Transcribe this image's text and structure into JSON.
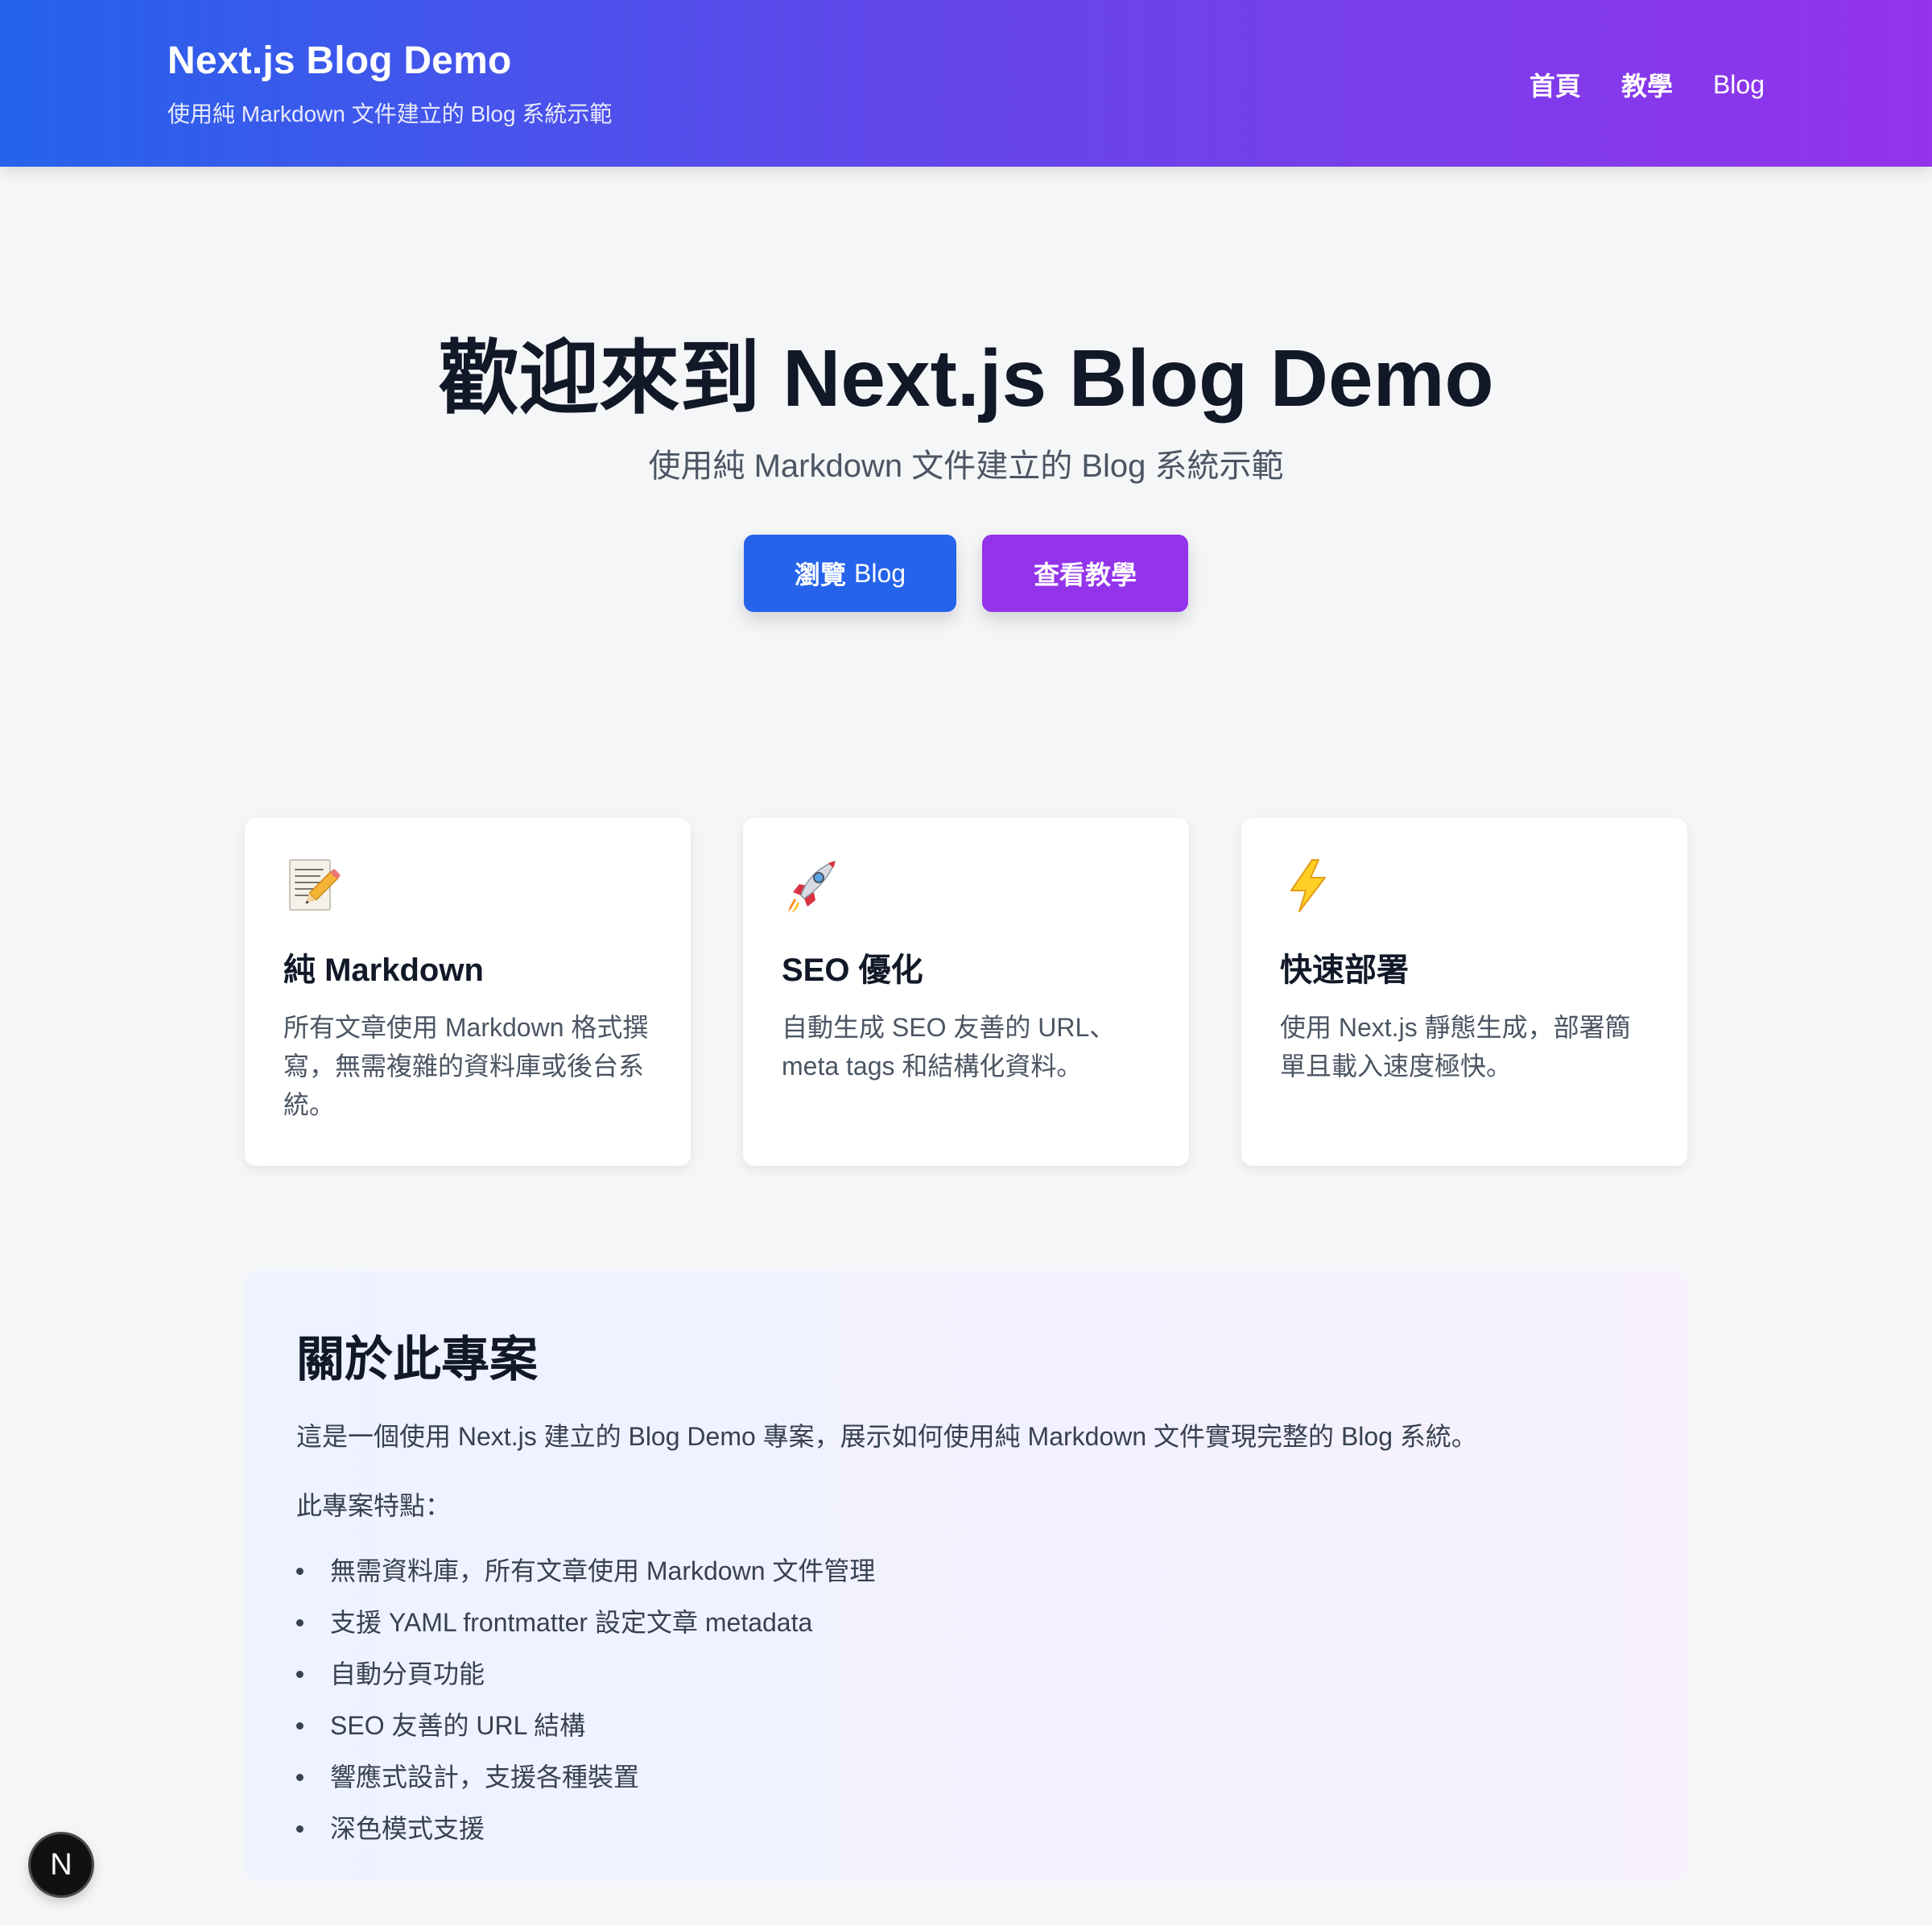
{
  "header": {
    "title": "Next.js Blog Demo",
    "subtitle": "使用純 Markdown 文件建立的 Blog 系統示範",
    "nav": [
      {
        "label": "首頁"
      },
      {
        "label": "教學"
      },
      {
        "label": "Blog"
      }
    ]
  },
  "hero": {
    "title": "歡迎來到 Next.js Blog Demo",
    "subtitle": "使用純 Markdown 文件建立的 Blog 系統示範",
    "buttons": {
      "browse_prefix": "瀏覽",
      "browse_suffix": "Blog",
      "tutorial": "查看教學"
    }
  },
  "features": [
    {
      "icon": "memo-icon",
      "title": "純 Markdown",
      "description": "所有文章使用 Markdown 格式撰寫，無需複雜的資料庫或後台系統。"
    },
    {
      "icon": "rocket-icon",
      "title": "SEO 優化",
      "description": "自動生成 SEO 友善的 URL、meta tags 和結構化資料。"
    },
    {
      "icon": "lightning-icon",
      "title": "快速部署",
      "description": "使用 Next.js 靜態生成，部署簡單且載入速度極快。"
    }
  ],
  "about": {
    "title": "關於此專案",
    "description": "這是一個使用 Next.js 建立的 Blog Demo 專案，展示如何使用純 Markdown 文件實現完整的 Blog 系統。",
    "features_label": "此專案特點：",
    "items": [
      "無需資料庫，所有文章使用 Markdown 文件管理",
      "支援 YAML frontmatter 設定文章 metadata",
      "自動分頁功能",
      "SEO 友善的 URL 結構",
      "響應式設計，支援各種裝置",
      "深色模式支援"
    ]
  },
  "badge": {
    "label": "N"
  },
  "colors": {
    "gradient_start": "#2563eb",
    "gradient_end": "#9333ea",
    "primary_button": "#2563eb",
    "secondary_button": "#9333ea",
    "page_background": "#f5f6f8"
  }
}
